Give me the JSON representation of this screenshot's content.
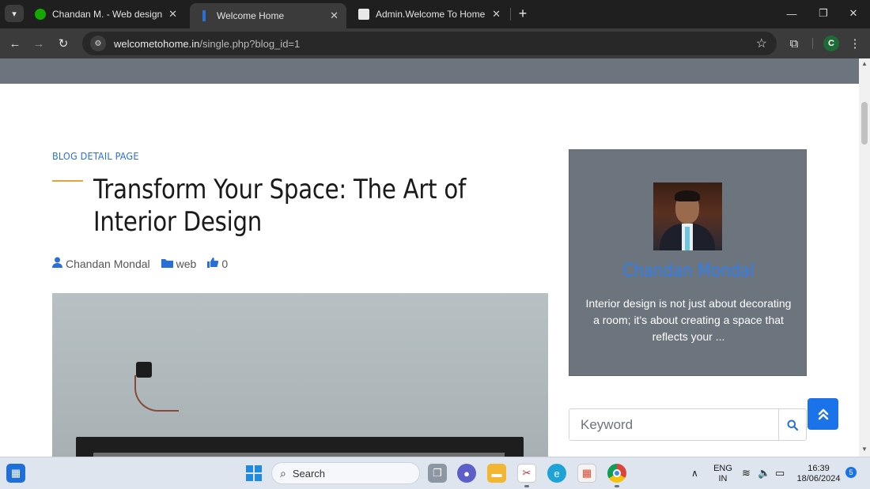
{
  "browser": {
    "tabs": [
      {
        "title": "Chandan M. - Web design - Up",
        "favicon_color": "#14a800",
        "active": false
      },
      {
        "title": "Welcome Home",
        "favicon_color": "#2a6fd6",
        "active": true
      },
      {
        "title": "Admin.Welcome To Home",
        "favicon_color": "#3c78c8",
        "active": false
      }
    ],
    "url_host": "welcometohome.in",
    "url_path": "/single.php?blog_id=1",
    "profile_initial": "C"
  },
  "page": {
    "blog_label": "BLOG DETAIL PAGE",
    "title": "Transform Your Space: The Art of Interior Design",
    "meta": {
      "author": "Chandan Mondal",
      "category": "web",
      "likes": "0"
    },
    "sidebar": {
      "author_name": "Chandan Mondal",
      "bio": "Interior design is not just about decorating a room; it's about creating a space that reflects your ..."
    },
    "search": {
      "placeholder": "Keyword"
    }
  },
  "taskbar": {
    "search_label": "Search",
    "lang_top": "ENG",
    "lang_bottom": "IN",
    "time": "16:39",
    "date": "18/06/2024",
    "notification_count": "5"
  },
  "colors": {
    "accent": "#2a6fd6",
    "hero_gray": "#6c757d",
    "title_rule": "#e9a13b",
    "back_to_top": "#1a73e8"
  }
}
